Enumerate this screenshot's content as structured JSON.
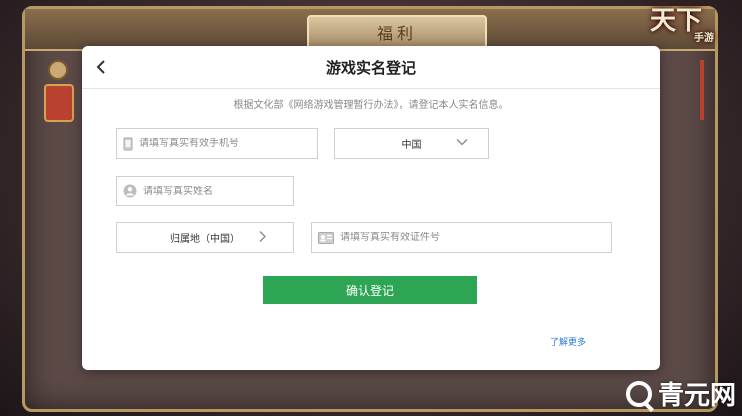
{
  "background": {
    "panel_title": "福利",
    "logo_main": "天下",
    "logo_sub": "手游",
    "watermark_text": "青元网"
  },
  "dialog": {
    "title": "游戏实名登记",
    "notice": "根据文化部《网络游戏管理暂行办法》，请登记本人实名信息。",
    "phone_placeholder": "请填写真实有效手机号",
    "region_value": "中国",
    "name_placeholder": "请填写真实姓名",
    "origin_value": "归属地（中国）",
    "id_placeholder": "请填写真实有效证件号",
    "confirm_label": "确认登记",
    "learn_more_label": "了解更多"
  },
  "colors": {
    "confirm_green": "#2ea455",
    "link_blue": "#2b7bd8"
  },
  "icons": {
    "back": "chevron-left-icon",
    "phone": "phone-icon",
    "person": "person-icon",
    "id_card": "id-card-icon",
    "dropdown": "chevron-down-icon",
    "origin_arrow": "chevron-right-icon"
  }
}
